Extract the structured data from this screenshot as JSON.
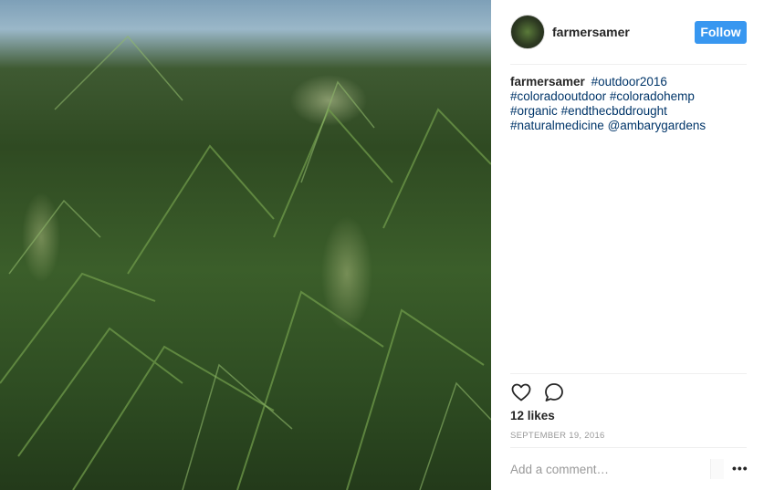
{
  "post": {
    "image_alt": "cannabis plants growing outdoors",
    "username": "farmersamer",
    "follow_label": "Follow",
    "caption": {
      "username": "farmersamer",
      "tag_1": "#outdoor2016",
      "tag_2": "#coloradooutdoor",
      "tag_3": "#coloradohemp",
      "tag_4": "#organic",
      "tag_5": "#endthecbddrought",
      "tag_6": "#naturalmedicine",
      "mention": "@ambarygardens"
    },
    "likes": "12 likes",
    "date": "SEPTEMBER 19, 2016",
    "comment_placeholder": "Add a comment…",
    "more_label": "•••"
  },
  "icons": {
    "like": "heart-icon",
    "comment": "speech-bubble-icon",
    "more": "ellipsis-icon"
  },
  "colors": {
    "follow_button": "#3897f0",
    "hashtag": "#003569",
    "muted": "#999999",
    "text": "#262626"
  }
}
